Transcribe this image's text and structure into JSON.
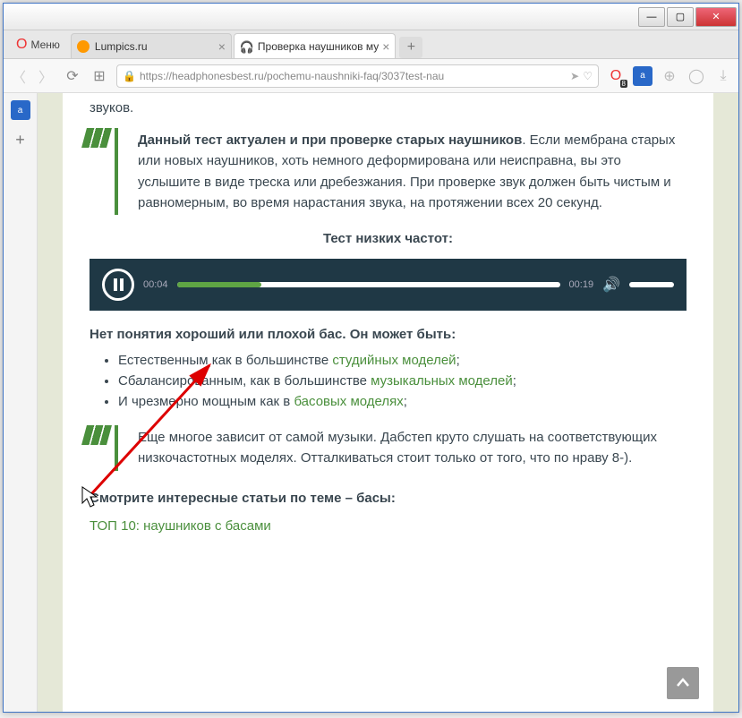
{
  "window": {
    "min": "—",
    "max": "▢",
    "close": "✕"
  },
  "menu_label": "Меню",
  "tabs": [
    {
      "title": "Lumpics.ru"
    },
    {
      "title": "Проверка наушников му"
    }
  ],
  "newtab": "+",
  "url": "https://headphonesbest.ru/pochemu-naushniki-faq/3037test-nau",
  "ext_badge": "8",
  "article": {
    "intro_tail": "звуков.",
    "quote1_bold": "Данный тест актуален и при проверке старых наушников",
    "quote1_rest": ". Если мембрана старых или новых наушников, хоть немного деформирована или неисправна, вы это услышите в виде треска или дребезжания. При проверке звук должен быть чистым и равномерным, во время нарастания звука, на протяжении всех 20 секунд.",
    "test_title": "Тест низких частот:",
    "player": {
      "current": "00:04",
      "total": "00:19"
    },
    "bass_heading": "Нет понятия хороший или плохой бас. Он может быть:",
    "bullets": [
      {
        "pre": "Естественным как в большинстве ",
        "link": "студийных моделей",
        "post": ";"
      },
      {
        "pre": "Сбалансированным, как в большинстве ",
        "link": "музыкальных моделей",
        "post": ";"
      },
      {
        "pre": "И чрезмерно мощным как в ",
        "link": "басовых моделях",
        "post": ";"
      }
    ],
    "quote2": "Еще многое зависит от самой музыки. Дабстеп круто слушать на соответствующих низкочастотных моделях. Отталкиваться стоит только от того, что по нраву  8-).",
    "related_title": "Смотрите интересные статьи по теме – басы:",
    "related_item": "ТОП 10: наушников с басами"
  }
}
